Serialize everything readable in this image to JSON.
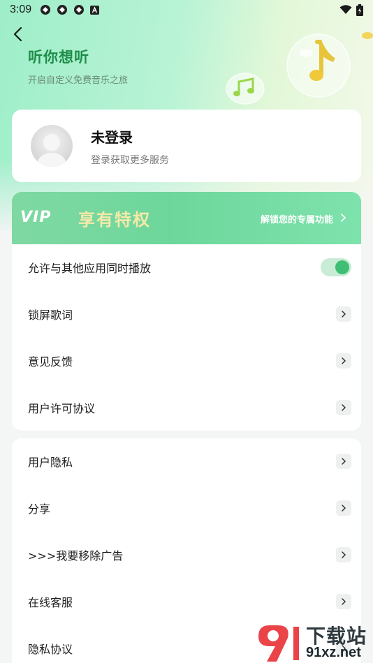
{
  "status_bar": {
    "time": "3:09"
  },
  "header": {
    "title": "听你想听",
    "subtitle": "开启自定义免费音乐之旅"
  },
  "user": {
    "name": "未登录",
    "subtitle": "登录获取更多服务"
  },
  "vip": {
    "logo": "VIP",
    "title": "享有特权",
    "link": "解锁您的专属功能"
  },
  "settings_group_1": [
    {
      "label": "允许与其他应用同时播放",
      "type": "toggle",
      "on": true
    },
    {
      "label": "锁屏歌词",
      "type": "link"
    },
    {
      "label": "意见反馈",
      "type": "link"
    },
    {
      "label": "用户许可协议",
      "type": "link"
    }
  ],
  "settings_group_2": [
    {
      "label": "用户隐私",
      "type": "link"
    },
    {
      "label": "分享",
      "type": "link"
    },
    {
      "label": ">>>我要移除广告",
      "type": "link"
    },
    {
      "label": "在线客服",
      "type": "link"
    },
    {
      "label": "隐私协议",
      "type": "link"
    }
  ],
  "watermark": {
    "line1": "下载站",
    "line2": "91xz.net"
  },
  "colors": {
    "accent_green": "#3fbf74",
    "title_green": "#1f8e4a",
    "vip_gold": "#f6e9a9"
  },
  "icons": {
    "back": "back-arrow-icon",
    "chevron": "chevron-right-icon",
    "music_note": "music-note-icon"
  }
}
